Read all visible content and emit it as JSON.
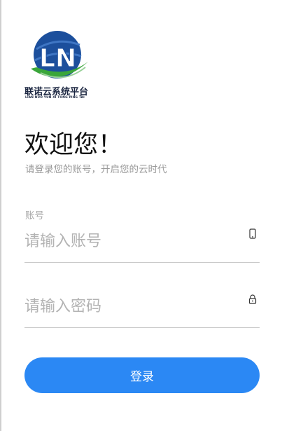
{
  "brand": {
    "name_cn": "联诺云系统平台",
    "name_pinyin": "LIAN NUO YUN XI TONG PING TAI",
    "logo_letters": "LN",
    "colors": {
      "blue": "#1c4f9c",
      "green": "#3aa63a"
    }
  },
  "welcome": {
    "title": "欢迎您！",
    "subtitle": "请登录您的账号，开启您的云时代"
  },
  "account": {
    "label": "账号",
    "placeholder": "请输入账号",
    "value": "",
    "icon": "phone-icon"
  },
  "password": {
    "placeholder": "请输入密码",
    "value": "",
    "icon": "lock-icon"
  },
  "login_button": {
    "label": "登录",
    "color": "#2b88f4"
  }
}
